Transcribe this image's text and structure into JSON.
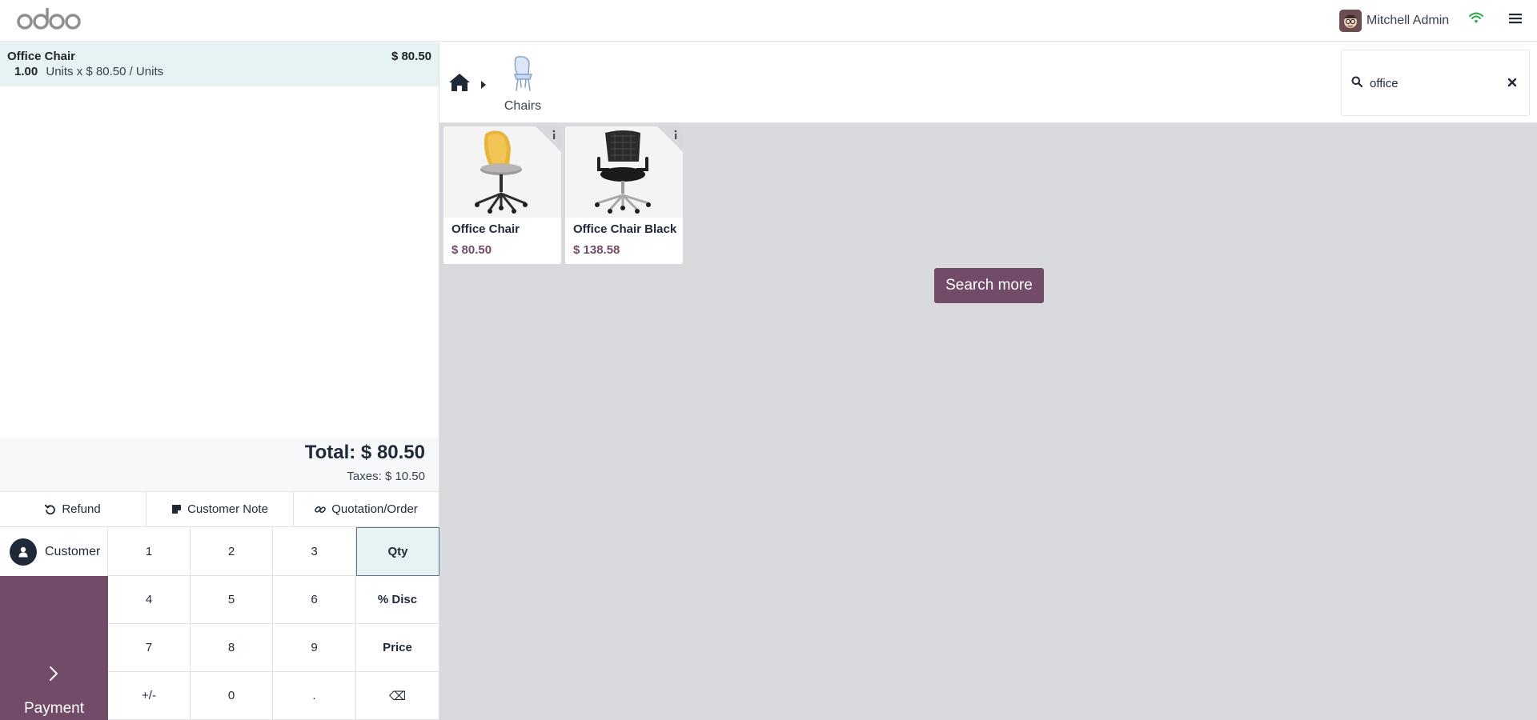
{
  "navbar": {
    "logo_text": "odoo",
    "user_name": "Mitchell Admin",
    "icons": [
      "odoo-logo",
      "user-avatar",
      "wifi-icon",
      "menu-icon"
    ]
  },
  "order": {
    "lines": [
      {
        "product": "Office Chair",
        "price": "$ 80.50",
        "quantity": "1.00",
        "detail": "Units x $ 80.50 / Units"
      }
    ],
    "total": "Total: $ 80.50",
    "taxes": "Taxes: $ 10.50"
  },
  "controls": {
    "refund": "Refund",
    "customer_note": "Customer Note",
    "quotation_order": "Quotation/Order"
  },
  "customer_label": "Customer",
  "payment_label": "Payment",
  "numpad": {
    "k1": "1",
    "k2": "2",
    "k3": "3",
    "qty": "Qty",
    "k4": "4",
    "k5": "5",
    "k6": "6",
    "disc": "% Disc",
    "k7": "7",
    "k8": "8",
    "k9": "9",
    "price": "Price",
    "plusminus": "+/-",
    "k0": "0",
    "dot": ".",
    "backspace": "⌫",
    "active_mode": "Qty"
  },
  "categories": {
    "current": "Chairs"
  },
  "search": {
    "value": "office"
  },
  "products": [
    {
      "name": "Office Chair",
      "price": "$ 80.50"
    },
    {
      "name": "Office Chair Black",
      "price": "$ 138.58"
    }
  ],
  "search_more": "Search more",
  "colors": {
    "brand": "#714b67",
    "selected_line": "#e6f2f3",
    "products_background": "#d8dadd",
    "wifi": "#28a745"
  }
}
